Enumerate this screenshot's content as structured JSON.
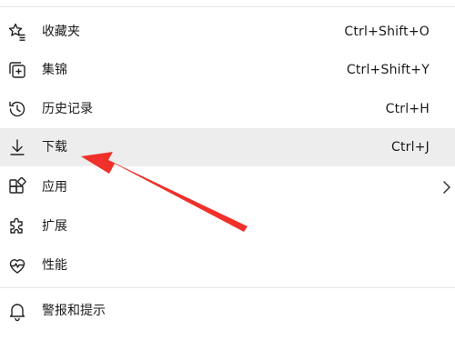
{
  "menu": {
    "items": [
      {
        "label": "收藏夹",
        "shortcut": "Ctrl+Shift+O",
        "icon": "favorites-star-icon"
      },
      {
        "label": "集锦",
        "shortcut": "Ctrl+Shift+Y",
        "icon": "collections-icon"
      },
      {
        "label": "历史记录",
        "shortcut": "Ctrl+H",
        "icon": "history-icon"
      },
      {
        "label": "下载",
        "shortcut": "Ctrl+J",
        "icon": "download-icon"
      },
      {
        "label": "应用",
        "shortcut": "",
        "icon": "apps-icon"
      },
      {
        "label": "扩展",
        "shortcut": "",
        "icon": "extensions-icon"
      },
      {
        "label": "性能",
        "shortcut": "",
        "icon": "performance-icon"
      },
      {
        "label": "警报和提示",
        "shortcut": "",
        "icon": "bell-icon"
      }
    ]
  },
  "colors": {
    "highlight_bg": "#ededed",
    "annotation_arrow": "#f0302a",
    "text": "#1a1a1a"
  }
}
